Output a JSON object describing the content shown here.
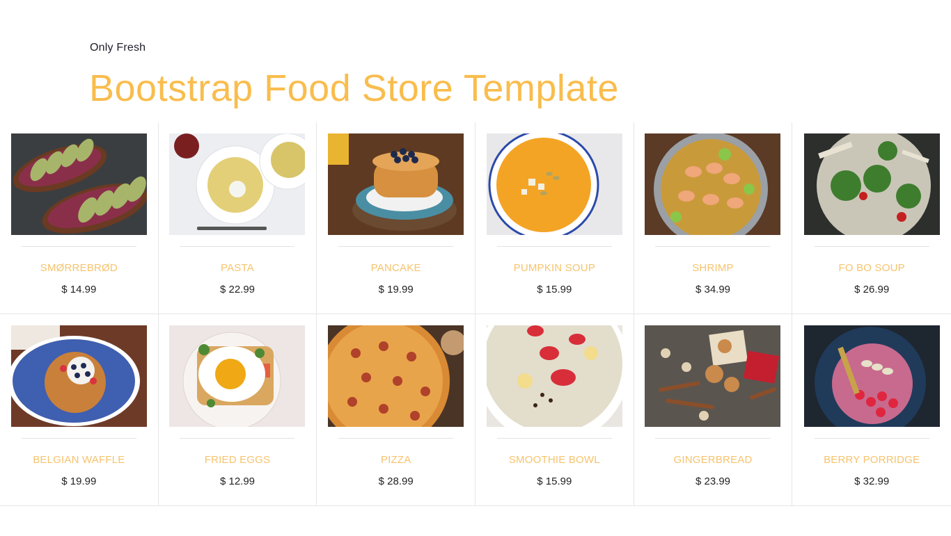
{
  "header": {
    "tagline": "Only Fresh",
    "title": "Bootstrap Food Store Template"
  },
  "colors": {
    "accent": "#f9bd4d",
    "item_name": "#f6c36d",
    "divider": "#e6e6e6"
  },
  "products": [
    {
      "name": "SMØRREBRØD",
      "price": "$ 14.99",
      "image": "avocado-toast-image"
    },
    {
      "name": "PASTA",
      "price": "$ 22.99",
      "image": "pasta-plate-image"
    },
    {
      "name": "PANCAKE",
      "price": "$ 19.99",
      "image": "pancake-stack-image"
    },
    {
      "name": "PUMPKIN SOUP",
      "price": "$ 15.99",
      "image": "pumpkin-soup-image"
    },
    {
      "name": "SHRIMP",
      "price": "$ 34.99",
      "image": "shrimp-pan-image"
    },
    {
      "name": "FO BO SOUP",
      "price": "$ 26.99",
      "image": "pho-soup-image"
    },
    {
      "name": "BELGIAN WAFFLE",
      "price": "$ 19.99",
      "image": "belgian-waffle-image"
    },
    {
      "name": "FRIED EGGS",
      "price": "$ 12.99",
      "image": "fried-eggs-image"
    },
    {
      "name": "PIZZA",
      "price": "$ 28.99",
      "image": "pizza-image"
    },
    {
      "name": "SMOOTHIE BOWL",
      "price": "$ 15.99",
      "image": "smoothie-bowl-image"
    },
    {
      "name": "GINGERBREAD",
      "price": "$ 23.99",
      "image": "gingerbread-image"
    },
    {
      "name": "BERRY PORRIDGE",
      "price": "$ 32.99",
      "image": "berry-porridge-image"
    }
  ]
}
